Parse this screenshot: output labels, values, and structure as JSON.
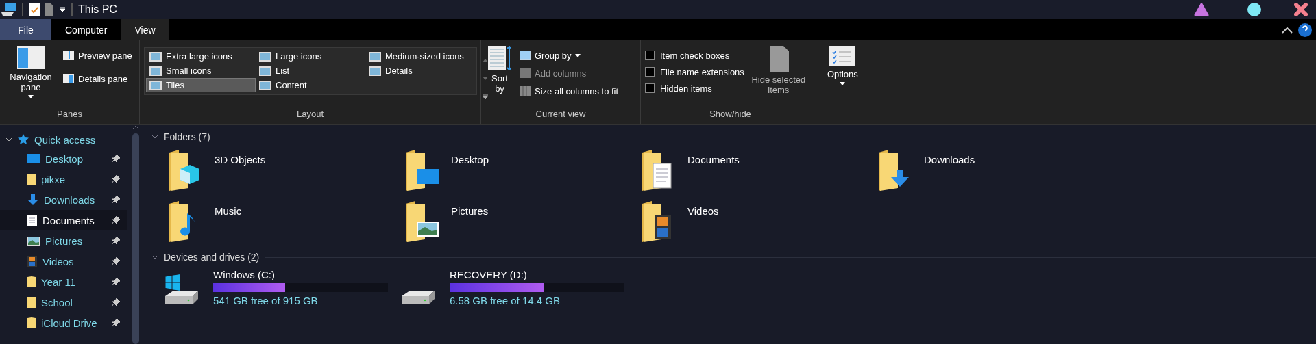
{
  "window": {
    "title": "This PC"
  },
  "tabs": [
    {
      "label": "File",
      "kind": "file",
      "selected": false
    },
    {
      "label": "Computer",
      "kind": "tab",
      "selected": false
    },
    {
      "label": "View",
      "kind": "tab",
      "selected": true
    }
  ],
  "ribbon": {
    "panes": {
      "label": "Panes",
      "navigation_pane": "Navigation pane",
      "preview_pane": "Preview pane",
      "details_pane": "Details pane"
    },
    "layout": {
      "label": "Layout",
      "items": [
        {
          "label": "Extra large icons",
          "selected": false
        },
        {
          "label": "Large icons",
          "selected": false
        },
        {
          "label": "Medium-sized icons",
          "selected": false
        },
        {
          "label": "Small icons",
          "selected": false
        },
        {
          "label": "List",
          "selected": false
        },
        {
          "label": "Details",
          "selected": false
        },
        {
          "label": "Tiles",
          "selected": true
        },
        {
          "label": "Content",
          "selected": false
        }
      ]
    },
    "current_view": {
      "label": "Current view",
      "sort_by": "Sort by",
      "group_by": "Group by",
      "add_columns": "Add columns",
      "size_columns": "Size all columns to fit"
    },
    "show_hide": {
      "label": "Show/hide",
      "checkboxes": [
        {
          "label": "Item check boxes",
          "checked": false
        },
        {
          "label": "File name extensions",
          "checked": false
        },
        {
          "label": "Hidden items",
          "checked": false
        }
      ],
      "hide_selected": "Hide selected items"
    },
    "options": {
      "label": "Options"
    }
  },
  "sidebar": {
    "quick_access": {
      "label": "Quick access",
      "expanded": true
    },
    "items": [
      {
        "label": "Desktop",
        "kind": "desktop",
        "selected": false
      },
      {
        "label": "pikxe",
        "kind": "folder",
        "selected": false
      },
      {
        "label": "Downloads",
        "kind": "downloads",
        "selected": false
      },
      {
        "label": "Documents",
        "kind": "documents",
        "selected": true
      },
      {
        "label": "Pictures",
        "kind": "pictures",
        "selected": false
      },
      {
        "label": "Videos",
        "kind": "videos",
        "selected": false
      },
      {
        "label": "Year 11",
        "kind": "folder",
        "selected": false
      },
      {
        "label": "School",
        "kind": "folder",
        "selected": false
      },
      {
        "label": "iCloud Drive",
        "kind": "folder",
        "selected": false
      }
    ]
  },
  "folders": {
    "heading": "Folders (7)",
    "items": [
      {
        "name": "3D Objects",
        "kind": "objects"
      },
      {
        "name": "Desktop",
        "kind": "desktop"
      },
      {
        "name": "Documents",
        "kind": "documents"
      },
      {
        "name": "Downloads",
        "kind": "downloads"
      },
      {
        "name": "Music",
        "kind": "music"
      },
      {
        "name": "Pictures",
        "kind": "pictures"
      },
      {
        "name": "Videos",
        "kind": "videos"
      }
    ]
  },
  "drives": {
    "heading": "Devices and drives (2)",
    "items": [
      {
        "name": "Windows (C:)",
        "kind": "system",
        "level": 0.41,
        "free": "541 GB free of 915 GB"
      },
      {
        "name": "RECOVERY (D:)",
        "kind": "drive",
        "level": 0.54,
        "free": "6.58 GB free of 14.4 GB"
      }
    ]
  }
}
